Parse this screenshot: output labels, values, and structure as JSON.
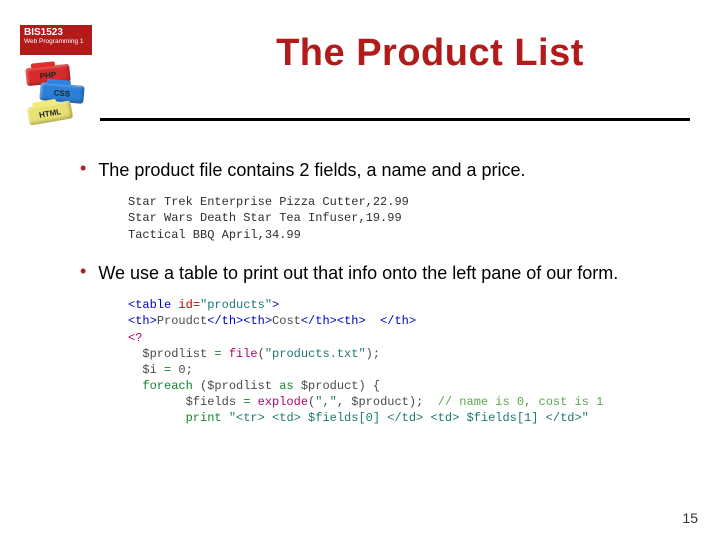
{
  "course": {
    "code": "BIS1523",
    "subtitle": "Web Programming 1"
  },
  "bricks": {
    "php": "PHP",
    "css": "CSS",
    "html": "HTML"
  },
  "title": "The Product List",
  "bullets": {
    "b1": "The product file contains 2 fields, a name and a price.",
    "b2": "We use a table to print out that info onto the left pane of our form."
  },
  "code1": {
    "l1": "Star Trek Enterprise Pizza Cutter,22.99",
    "l2": "Star Wars Death Star Tea Infuser,19.99",
    "l3": "Tactical BBQ April,34.99"
  },
  "code2": {
    "l1a": "<table ",
    "l1b": "id=",
    "l1c": "\"products\"",
    "l1d": ">",
    "l2a": "<th>",
    "l2b": "Proudct",
    "l2c": "</th><th>",
    "l2d": "Cost",
    "l2e": "</th><th>  </th>",
    "l3": "<?",
    "l4a": "  $prodlist ",
    "l4b": "= ",
    "l4c": "file",
    "l4d": "(",
    "l4e": "\"products.txt\"",
    "l4f": ");",
    "l5a": "  $i ",
    "l5b": "= ",
    "l5c": "0",
    "l5d": ";",
    "l6a": "  foreach ",
    "l6b": "($prodlist ",
    "l6c": "as ",
    "l6d": "$product) {",
    "l7a": "        $fields ",
    "l7b": "= ",
    "l7c": "explode",
    "l7d": "(",
    "l7e": "\",\"",
    "l7f": ", $product);  ",
    "l7g": "// name is 0, cost is 1",
    "l8a": "        print ",
    "l8b": "\"<tr> <td> $fields[0] </td> <td> $fields[1] </td>\""
  },
  "page_number": "15"
}
